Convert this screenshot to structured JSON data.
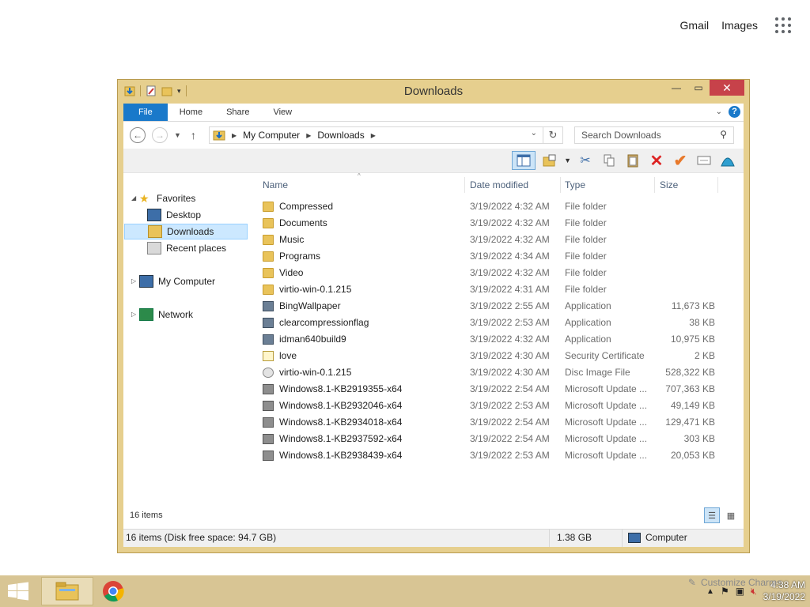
{
  "browser_links": {
    "gmail": "Gmail",
    "images": "Images"
  },
  "window": {
    "title": "Downloads",
    "ribbon": {
      "tabs": [
        "File",
        "Home",
        "Share",
        "View"
      ]
    },
    "address": {
      "crumbs": [
        "My Computer",
        "Downloads"
      ]
    },
    "search_placeholder": "Search Downloads",
    "nav": {
      "favorites": "Favorites",
      "desktop": "Desktop",
      "downloads": "Downloads",
      "recent": "Recent places",
      "my_computer": "My Computer",
      "network": "Network"
    },
    "columns": {
      "name": "Name",
      "date": "Date modified",
      "type": "Type",
      "size": "Size"
    },
    "files": [
      {
        "name": "Compressed",
        "date": "3/19/2022 4:32 AM",
        "type": "File folder",
        "size": "",
        "icon": "folder"
      },
      {
        "name": "Documents",
        "date": "3/19/2022 4:32 AM",
        "type": "File folder",
        "size": "",
        "icon": "folder"
      },
      {
        "name": "Music",
        "date": "3/19/2022 4:32 AM",
        "type": "File folder",
        "size": "",
        "icon": "folder"
      },
      {
        "name": "Programs",
        "date": "3/19/2022 4:34 AM",
        "type": "File folder",
        "size": "",
        "icon": "folder"
      },
      {
        "name": "Video",
        "date": "3/19/2022 4:32 AM",
        "type": "File folder",
        "size": "",
        "icon": "folder"
      },
      {
        "name": "virtio-win-0.1.215",
        "date": "3/19/2022 4:31 AM",
        "type": "File folder",
        "size": "",
        "icon": "folder"
      },
      {
        "name": "BingWallpaper",
        "date": "3/19/2022 2:55 AM",
        "type": "Application",
        "size": "11,673 KB",
        "icon": "app"
      },
      {
        "name": "clearcompressionflag",
        "date": "3/19/2022 2:53 AM",
        "type": "Application",
        "size": "38 KB",
        "icon": "app"
      },
      {
        "name": "idman640build9",
        "date": "3/19/2022 4:32 AM",
        "type": "Application",
        "size": "10,975 KB",
        "icon": "app"
      },
      {
        "name": "love",
        "date": "3/19/2022 4:30 AM",
        "type": "Security Certificate",
        "size": "2 KB",
        "icon": "cert"
      },
      {
        "name": "virtio-win-0.1.215",
        "date": "3/19/2022 4:30 AM",
        "type": "Disc Image File",
        "size": "528,322 KB",
        "icon": "disc"
      },
      {
        "name": "Windows8.1-KB2919355-x64",
        "date": "3/19/2022 2:54 AM",
        "type": "Microsoft Update ...",
        "size": "707,363 KB",
        "icon": "upd"
      },
      {
        "name": "Windows8.1-KB2932046-x64",
        "date": "3/19/2022 2:53 AM",
        "type": "Microsoft Update ...",
        "size": "49,149 KB",
        "icon": "upd"
      },
      {
        "name": "Windows8.1-KB2934018-x64",
        "date": "3/19/2022 2:54 AM",
        "type": "Microsoft Update ...",
        "size": "129,471 KB",
        "icon": "upd"
      },
      {
        "name": "Windows8.1-KB2937592-x64",
        "date": "3/19/2022 2:54 AM",
        "type": "Microsoft Update ...",
        "size": "303 KB",
        "icon": "upd"
      },
      {
        "name": "Windows8.1-KB2938439-x64",
        "date": "3/19/2022 2:53 AM",
        "type": "Microsoft Update ...",
        "size": "20,053 KB",
        "icon": "upd"
      }
    ],
    "item_count": "16 items",
    "status": {
      "left": "16 items (Disk free space: 94.7 GB)",
      "size": "1.38 GB",
      "location": "Computer"
    }
  },
  "taskbar": {
    "customize": "Customize Charms",
    "time": "4:38 AM",
    "date": "3/19/2022"
  },
  "colors": {
    "frame": "#e6cf8e",
    "taskbar": "#d8c594",
    "accent": "#1979ca",
    "close": "#c7424a"
  }
}
